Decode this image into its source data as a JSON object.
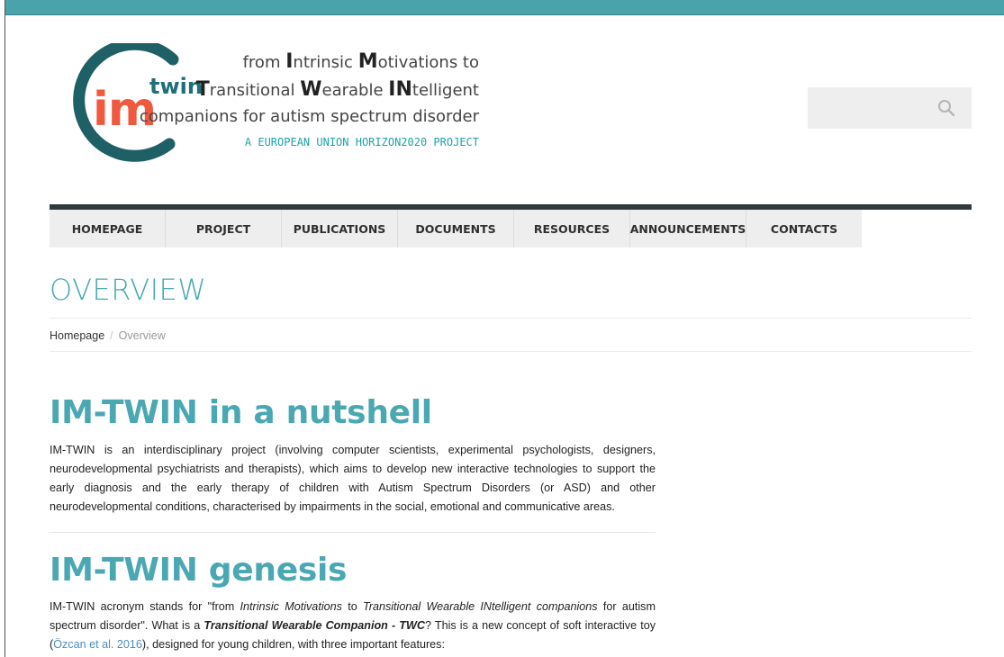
{
  "logo": {
    "im": "im",
    "twin": "twin",
    "tagline1_a": "from ",
    "tagline1_I": "I",
    "tagline1_b": "ntrinsic ",
    "tagline1_M": "M",
    "tagline1_c": "otivations to",
    "tagline2_T": "T",
    "tagline2_a": "ransitional ",
    "tagline2_W": "W",
    "tagline2_b": "earable ",
    "tagline2_IN": "IN",
    "tagline2_c": "telligent",
    "tagline3": "companions for autism spectrum disorder",
    "eu": "A EUROPEAN UNION HORIZON2020 PROJECT"
  },
  "search": {
    "placeholder": "",
    "value": ""
  },
  "nav": [
    "HOMEPAGE",
    "PROJECT",
    "PUBLICATIONS",
    "DOCUMENTS",
    "RESOURCES",
    "ANNOUNCEMENTS",
    "CONTACTS"
  ],
  "page": {
    "title": "OVERVIEW",
    "breadcrumb_home": "Homepage",
    "breadcrumb_sep": "/",
    "breadcrumb_current": "Overview"
  },
  "sections": {
    "nutshell_title": "IM-TWIN in a nutshell",
    "nutshell_text": "IM-TWIN is an interdisciplinary project (involving computer scientists, experimental psychologists, designers, neurodevelopmental psychiatrists and therapists), which aims to develop new interactive technologies to support the early diagnosis and the early therapy of children with Autism Spectrum Disorders (or ASD) and other neurodevelopmental conditions, characterised by impairments in the social, emotional and communicative areas.",
    "genesis_title": "IM-TWIN genesis",
    "genesis_a": "IM-TWIN acronym stands for \"from ",
    "genesis_i1": "Intrinsic Motivations",
    "genesis_b": " to ",
    "genesis_i2": "Transitional Wearable INtelligent companions",
    "genesis_c": " for autism spectrum disorder\". What is a ",
    "genesis_bi": "Transitional Wearable Companion - TWC",
    "genesis_d": "? This is a new concept of soft interactive toy (",
    "genesis_link": "Özcan et al. 2016",
    "genesis_e": "), designed for young children, with three important features:"
  }
}
